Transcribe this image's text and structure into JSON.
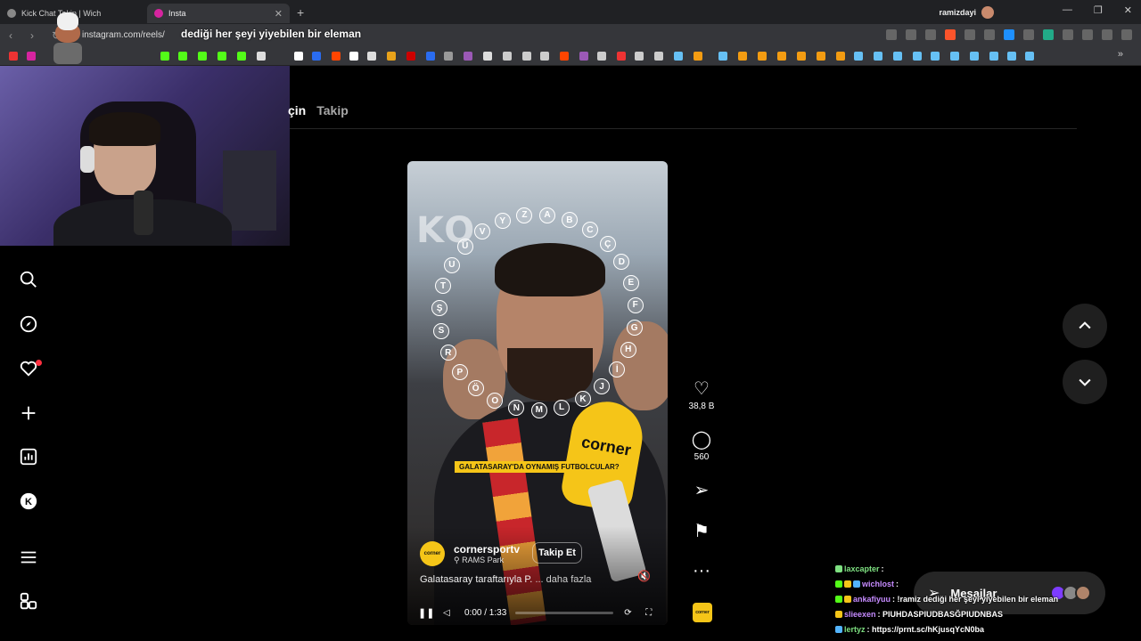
{
  "browser": {
    "tabs": [
      {
        "title": "Kick Chat Takip | Wich",
        "active": false
      },
      {
        "title": "Insta",
        "active": true
      }
    ],
    "profile_name": "ramizdayi",
    "url": "instagram.com/reels/",
    "overlay_text": "dediği her şeyi yiyebilen bir eleman",
    "accent": "#f5c518"
  },
  "feed": {
    "tab_for_you": "çin",
    "tab_following": "Takip"
  },
  "reel": {
    "letters": [
      "A",
      "B",
      "C",
      "Ç",
      "D",
      "E",
      "F",
      "G",
      "H",
      "İ",
      "J",
      "K",
      "L",
      "M",
      "N",
      "O",
      "Ö",
      "P",
      "R",
      "S",
      "Ş",
      "T",
      "U",
      "Ü",
      "V",
      "Y",
      "Z"
    ],
    "caption_banner": "GALATASARAY'DA OYNAMIŞ FUTBOLCULAR?",
    "mic_brand": "corner",
    "logo_text": "corner",
    "account_name": "cornersportv",
    "location": "RAMS Park",
    "follow_label": "Takip Et",
    "description": "Galatasaray taraftarıyla P.",
    "more_label": "... daha fazla",
    "time": "0:00 / 1:33",
    "progress": 0.0,
    "sign_text": "KO"
  },
  "actions": {
    "likes": "38,8 B",
    "comments": "560",
    "more_glyph": "···"
  },
  "messages": {
    "label": "Mesajlar"
  },
  "chat": [
    {
      "user": "laxcapter",
      "user_color": "#7ee081",
      "text": ":",
      "badges": [
        "#7ee081"
      ]
    },
    {
      "user": "wichlost",
      "user_color": "#c68bff",
      "text": ":",
      "badges": [
        "#53fc18",
        "#f5c518",
        "#53b4fc"
      ]
    },
    {
      "user": "ankafiyuu",
      "user_color": "#c68bff",
      "text": ": !ramiz dediği her şeyi yiyebilen bir eleman",
      "badges": [
        "#53fc18",
        "#f5c518"
      ]
    },
    {
      "user": "slieexen",
      "user_color": "#c68bff",
      "text": ": PIUHDASPIUDBASĞPIUDNBAS",
      "badges": [
        "#f5c518"
      ]
    },
    {
      "user": "lertyz",
      "user_color": "#7ee081",
      "text": ": https://prnt.sc/hKjusqYcN0ba",
      "badges": [
        "#53b4fc"
      ]
    }
  ]
}
